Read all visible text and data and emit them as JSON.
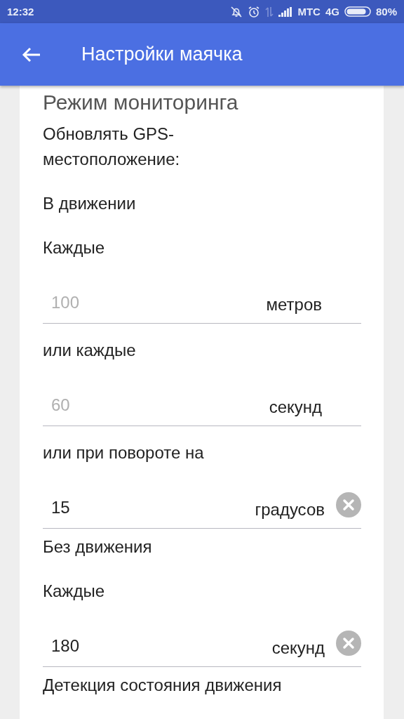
{
  "status_bar": {
    "time": "12:32",
    "carrier": "МТС",
    "network": "4G",
    "battery": "80%"
  },
  "app_bar": {
    "title": "Настройки маячка"
  },
  "items": [
    {
      "kind": "heading",
      "text": "Режим мониторинга"
    },
    {
      "kind": "label",
      "text": "Обновлять GPS-местоположение:"
    },
    {
      "kind": "section",
      "text": "В движении"
    },
    {
      "kind": "label",
      "text": "Каждые"
    },
    {
      "kind": "field",
      "placeholder": "100",
      "unit": "метров",
      "clearable": false
    },
    {
      "kind": "label",
      "text": "или каждые"
    },
    {
      "kind": "field",
      "placeholder": "60",
      "unit": "секунд",
      "clearable": false
    },
    {
      "kind": "label",
      "text": "или при повороте на"
    },
    {
      "kind": "field",
      "value": "15",
      "unit": "градусов",
      "clearable": true
    },
    {
      "kind": "section",
      "text": "Без движения"
    },
    {
      "kind": "label",
      "text": "Каждые"
    },
    {
      "kind": "field",
      "value": "180",
      "unit": "секунд",
      "clearable": true
    },
    {
      "kind": "section",
      "text": "Детекция состояния движения"
    }
  ]
}
